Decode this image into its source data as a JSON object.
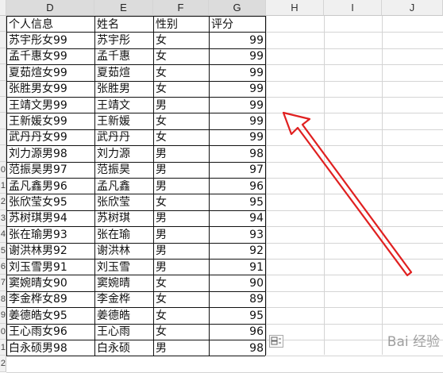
{
  "columns": [
    "D",
    "E",
    "F",
    "G",
    "H",
    "I",
    "J"
  ],
  "headers": {
    "d": "个人信息",
    "e": "姓名",
    "f": "性别",
    "g": "评分"
  },
  "row_numbers": [
    "",
    "",
    "",
    "",
    "",
    "",
    "",
    "",
    "",
    "0",
    "1",
    "2",
    "3",
    "4",
    "5",
    "6",
    "7",
    "8",
    "9",
    "0",
    "1",
    "2",
    "3"
  ],
  "rows": [
    {
      "d": "苏宇彤女99",
      "e": "苏宇彤",
      "f": "女",
      "g": "99"
    },
    {
      "d": "孟千惠女99",
      "e": "孟千惠",
      "f": "女",
      "g": "99"
    },
    {
      "d": "夏茹煊女99",
      "e": "夏茹煊",
      "f": "女",
      "g": "99"
    },
    {
      "d": "张胜男女99",
      "e": "张胜男",
      "f": "女",
      "g": "99"
    },
    {
      "d": "王靖文男99",
      "e": "王靖文",
      "f": "男",
      "g": "99"
    },
    {
      "d": "王新媛女99",
      "e": "王新媛",
      "f": "女",
      "g": "99"
    },
    {
      "d": "武丹丹女99",
      "e": "武丹丹",
      "f": "女",
      "g": "99"
    },
    {
      "d": "刘力源男98",
      "e": "刘力源",
      "f": "男",
      "g": "98"
    },
    {
      "d": "范振昊男97",
      "e": "范振昊",
      "f": "男",
      "g": "97"
    },
    {
      "d": "孟凡鑫男96",
      "e": "孟凡鑫",
      "f": "男",
      "g": "96"
    },
    {
      "d": "张欣莹女95",
      "e": "张欣莹",
      "f": "女",
      "g": "95"
    },
    {
      "d": "苏树琪男94",
      "e": "苏树琪",
      "f": "男",
      "g": "94"
    },
    {
      "d": "张在瑜男93",
      "e": "张在瑜",
      "f": "男",
      "g": "93"
    },
    {
      "d": "谢洪林男92",
      "e": "谢洪林",
      "f": "男",
      "g": "92"
    },
    {
      "d": "刘玉雪男91",
      "e": "刘玉雪",
      "f": "男",
      "g": "91"
    },
    {
      "d": "窦婉晴女90",
      "e": "窦婉晴",
      "f": "女",
      "g": "90"
    },
    {
      "d": "李金桦女89",
      "e": "李金桦",
      "f": "女",
      "g": "89"
    },
    {
      "d": "姜德皓女95",
      "e": "姜德皓",
      "f": "女",
      "g": "95"
    },
    {
      "d": "王心雨女96",
      "e": "王心雨",
      "f": "女",
      "g": "96"
    },
    {
      "d": "白永硕男98",
      "e": "白永硕",
      "f": "男",
      "g": "98"
    }
  ],
  "annotation": {
    "color": "#e02020"
  },
  "watermark": "Bai 经验"
}
